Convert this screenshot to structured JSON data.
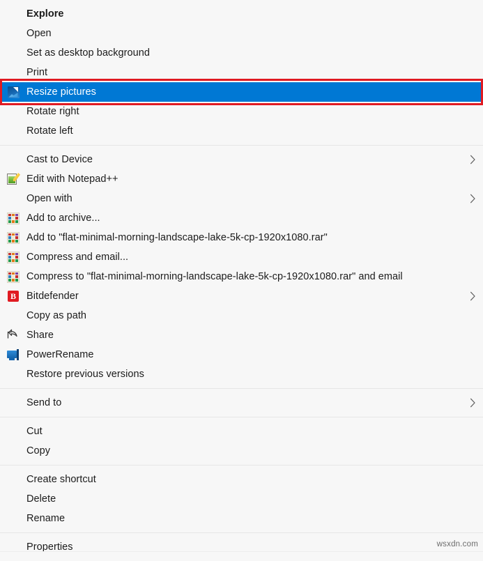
{
  "menu": {
    "background_color": "#f7f7f7",
    "selection_color": "#0078d4",
    "highlight_border_color": "#e01b22",
    "groups": [
      {
        "name": "primary",
        "items": [
          {
            "label": "Explore",
            "icon": null,
            "bold": true,
            "submenu": false,
            "selected": false
          },
          {
            "label": "Open",
            "icon": null,
            "bold": false,
            "submenu": false,
            "selected": false
          },
          {
            "label": "Set as desktop background",
            "icon": null,
            "bold": false,
            "submenu": false,
            "selected": false
          },
          {
            "label": "Print",
            "icon": null,
            "bold": false,
            "submenu": false,
            "selected": false
          },
          {
            "label": "Resize pictures",
            "icon": "image-resize-icon",
            "bold": false,
            "submenu": false,
            "selected": true
          },
          {
            "label": "Rotate right",
            "icon": null,
            "bold": false,
            "submenu": false,
            "selected": false
          },
          {
            "label": "Rotate left",
            "icon": null,
            "bold": false,
            "submenu": false,
            "selected": false
          }
        ]
      },
      {
        "name": "apps",
        "items": [
          {
            "label": "Cast to Device",
            "icon": null,
            "bold": false,
            "submenu": true,
            "selected": false
          },
          {
            "label": "Edit with Notepad++",
            "icon": "notepad-plus-plus-icon",
            "bold": false,
            "submenu": false,
            "selected": false
          },
          {
            "label": "Open with",
            "icon": null,
            "bold": false,
            "submenu": true,
            "selected": false
          },
          {
            "label": "Add to archive...",
            "icon": "winrar-icon",
            "bold": false,
            "submenu": false,
            "selected": false
          },
          {
            "label": "Add to \"flat-minimal-morning-landscape-lake-5k-cp-1920x1080.rar\"",
            "icon": "winrar-icon",
            "bold": false,
            "submenu": false,
            "selected": false
          },
          {
            "label": "Compress and email...",
            "icon": "winrar-icon",
            "bold": false,
            "submenu": false,
            "selected": false
          },
          {
            "label": "Compress to \"flat-minimal-morning-landscape-lake-5k-cp-1920x1080.rar\" and email",
            "icon": "winrar-icon",
            "bold": false,
            "submenu": false,
            "selected": false
          },
          {
            "label": "Bitdefender",
            "icon": "bitdefender-icon",
            "bold": false,
            "submenu": true,
            "selected": false
          },
          {
            "label": "Copy as path",
            "icon": null,
            "bold": false,
            "submenu": false,
            "selected": false
          },
          {
            "label": "Share",
            "icon": "share-icon",
            "bold": false,
            "submenu": false,
            "selected": false
          },
          {
            "label": "PowerRename",
            "icon": "powerrename-icon",
            "bold": false,
            "submenu": false,
            "selected": false
          },
          {
            "label": "Restore previous versions",
            "icon": null,
            "bold": false,
            "submenu": false,
            "selected": false
          }
        ]
      },
      {
        "name": "send",
        "items": [
          {
            "label": "Send to",
            "icon": null,
            "bold": false,
            "submenu": true,
            "selected": false
          }
        ]
      },
      {
        "name": "clipboard",
        "items": [
          {
            "label": "Cut",
            "icon": null,
            "bold": false,
            "submenu": false,
            "selected": false
          },
          {
            "label": "Copy",
            "icon": null,
            "bold": false,
            "submenu": false,
            "selected": false
          }
        ]
      },
      {
        "name": "file-ops",
        "items": [
          {
            "label": "Create shortcut",
            "icon": null,
            "bold": false,
            "submenu": false,
            "selected": false
          },
          {
            "label": "Delete",
            "icon": null,
            "bold": false,
            "submenu": false,
            "selected": false
          },
          {
            "label": "Rename",
            "icon": null,
            "bold": false,
            "submenu": false,
            "selected": false
          }
        ]
      },
      {
        "name": "properties",
        "items": [
          {
            "label": "Properties",
            "icon": null,
            "bold": false,
            "submenu": false,
            "selected": false
          }
        ]
      }
    ]
  },
  "watermark": {
    "text": "wsxdn.com"
  }
}
